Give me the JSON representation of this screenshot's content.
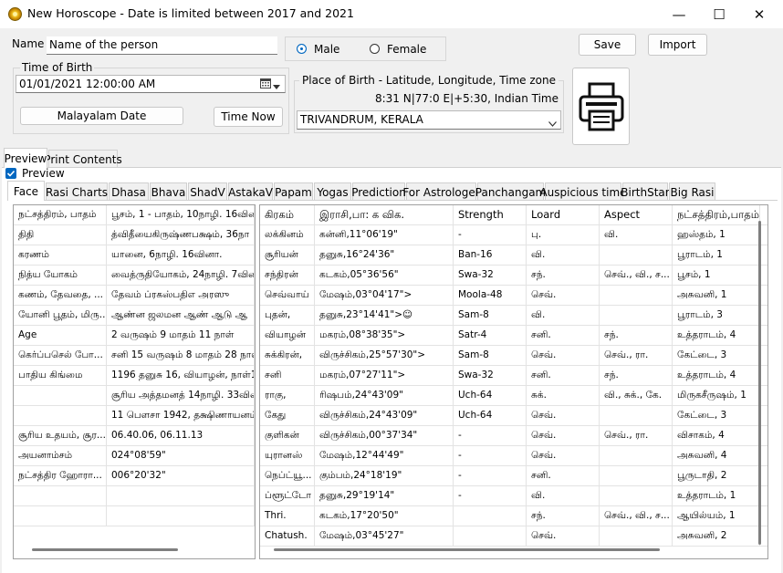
{
  "window": {
    "title": "New Horoscope - Date is limited between 2017 and 2021",
    "minimize_glyph": "—",
    "maximize_glyph": "☐",
    "close_glyph": "✕"
  },
  "form": {
    "name_label": "Name",
    "name_value": "Name of the person",
    "gender_male": "Male",
    "gender_female": "Female",
    "gender_selected": "Male",
    "save_label": "Save",
    "import_label": "Import",
    "time_of_birth_label": "Time of Birth",
    "datetime_value": "01/01/2021  12:00:00 AM",
    "malayalam_date_label": "Malayalam Date",
    "time_now_label": "Time Now",
    "place_label": "Place of Birth - Latitude, Longitude, Time zone",
    "coords_value": "8:31 N|77:0 E|+5:30, Indian Time",
    "place_value": "TRIVANDRUM, KERALA"
  },
  "top_tabs": [
    "Preview",
    "Print Contents"
  ],
  "preview_checkbox": {
    "label": "Preview",
    "checked": true
  },
  "inner_tabs": [
    "Face",
    "Rasi Charts",
    "Dhasa",
    "Bhava",
    "ShadV",
    "AstakaV",
    "Papam",
    "Yogas",
    "Prediction",
    "For Astrologer",
    "Panchangam",
    "Auspicious time",
    "BirthStar",
    "Big Rasi"
  ],
  "left_table": [
    [
      "நட்சத்திரம், பாதம்",
      "பூசம், 1 - பாதம், 10நாழி. 16வினா."
    ],
    [
      "திதி",
      "த்விதீயைகிருஷ்ணபக்ஷம், 36நா"
    ],
    [
      "கரணம்",
      "யானை, 6நாழி. 16வினா."
    ],
    [
      "நித்ய யோகம்",
      "வைத்ருதியோகம், 24நாழி. 7வின"
    ],
    [
      "கணம், தேவதை, ...",
      "தேவம் ப்ரகஸ்பதிஎ அரஸு"
    ],
    [
      "யோனி பூதம், மிரு...",
      "ஆண்ன ஜலமன ஆண் ஆடு ஆ"
    ],
    [
      "Age",
      "2 வருஷம் 9 மாதம் 11 நாள்"
    ],
    [
      "கெர்ப்பசெல் போ...",
      "சனி 15 வருஷம் 8 மாதம் 28 நாள்"
    ],
    [
      "பாதிய கிங்மை",
      "1196 தனுசு 16, வியாழன், நாள்187"
    ],
    [
      "",
      "சூரிய அத்தமனத் 14நாழி. 33வின"
    ],
    [
      "",
      "11 பௌசா 1942, தக்ஷிணாயனம், "
    ],
    [
      "சூரிய உதயம், சூர...",
      "06.40.06, 06.11.13"
    ],
    [
      "அயனாம்சம்",
      "024°08'59\""
    ],
    [
      "நட்சத்திர ஹோரா...",
      "006°20'32\""
    ],
    [
      "",
      ""
    ],
    [
      "",
      ""
    ]
  ],
  "planet_headers": [
    "கிரகம்",
    "இராசி,பா: க விக.",
    "Strength",
    "Loard",
    "Aspect",
    "நட்சத்திரம்,பாதம்"
  ],
  "planet_rows": [
    [
      "லக்கினம்",
      "கன்னி,11°06'19\"",
      "-",
      "பு.",
      "வி.",
      "ஹஸ்தம், 1"
    ],
    [
      "சூரியன்",
      "தனுசு,16°24'36\"",
      "Ban-16",
      "வி.",
      "",
      "பூராடம், 1"
    ],
    [
      "சந்திரன்",
      "கடகம்,05°36'56\"",
      "Swa-32",
      "சந்.",
      "செவ்., வி., ச...",
      "பூசம், 1"
    ],
    [
      "செவ்வாய்",
      "மேஷம்,03°04'17\">",
      "Moola-48",
      "செவ்.",
      "",
      "அசுவனி, 1"
    ],
    [
      "புதன்,",
      "தனுசு,23°14'41\">☺",
      "Sam-8",
      "வி.",
      "",
      "பூராடம், 3"
    ],
    [
      "வியாழன்",
      "மகரம்,08°38'35\">",
      "Satr-4",
      "சனி.",
      "சந்.",
      "உத்தராடம், 4"
    ],
    [
      "சுக்கிரன்,",
      "விருச்சிகம்,25°57'30\">",
      "Sam-8",
      "செவ்.",
      "செவ்., ரா.",
      "கேட்டை, 3"
    ],
    [
      "சனி",
      "மகரம்,07°27'11\">",
      "Swa-32",
      "சனி.",
      "சந்.",
      "உத்தராடம், 4"
    ],
    [
      "ராகு,",
      "ரிஷபம்,24°43'09\"",
      "Uch-64",
      "சுக்.",
      "வி., சுக்., கே.",
      "மிருகசீருஷம், 1"
    ],
    [
      "கேது",
      "விருச்சிகம்,24°43'09\"",
      "Uch-64",
      "செவ்.",
      "",
      "கேட்டை, 3"
    ],
    [
      "குளிகன்",
      "விருச்சிகம்,00°37'34\"",
      "-",
      "செவ்.",
      "செவ்., ரா.",
      "விசாகம், 4"
    ],
    [
      "யுரானஸ்",
      "மேஷம்,12°44'49\"",
      "-",
      "செவ்.",
      "",
      "அசுவனி, 4"
    ],
    [
      "நெப்ட்யூ...",
      "கும்பம்,24°18'19\"",
      "-",
      "சனி.",
      "",
      "பூருடாதி, 2"
    ],
    [
      "ப்ளூட்டோ",
      "தனுசு,29°19'14\"",
      "-",
      "வி.",
      "",
      "உத்தராடம், 1"
    ],
    [
      "Thri.",
      "கடகம்,17°20'50\"",
      "",
      "சந்.",
      "செவ்., வி., ச...",
      "ஆயில்யம், 1"
    ],
    [
      "Chatush.",
      "மேஷம்,03°45'27\"",
      "",
      "செவ்.",
      "",
      "அசுவனி, 2"
    ]
  ]
}
